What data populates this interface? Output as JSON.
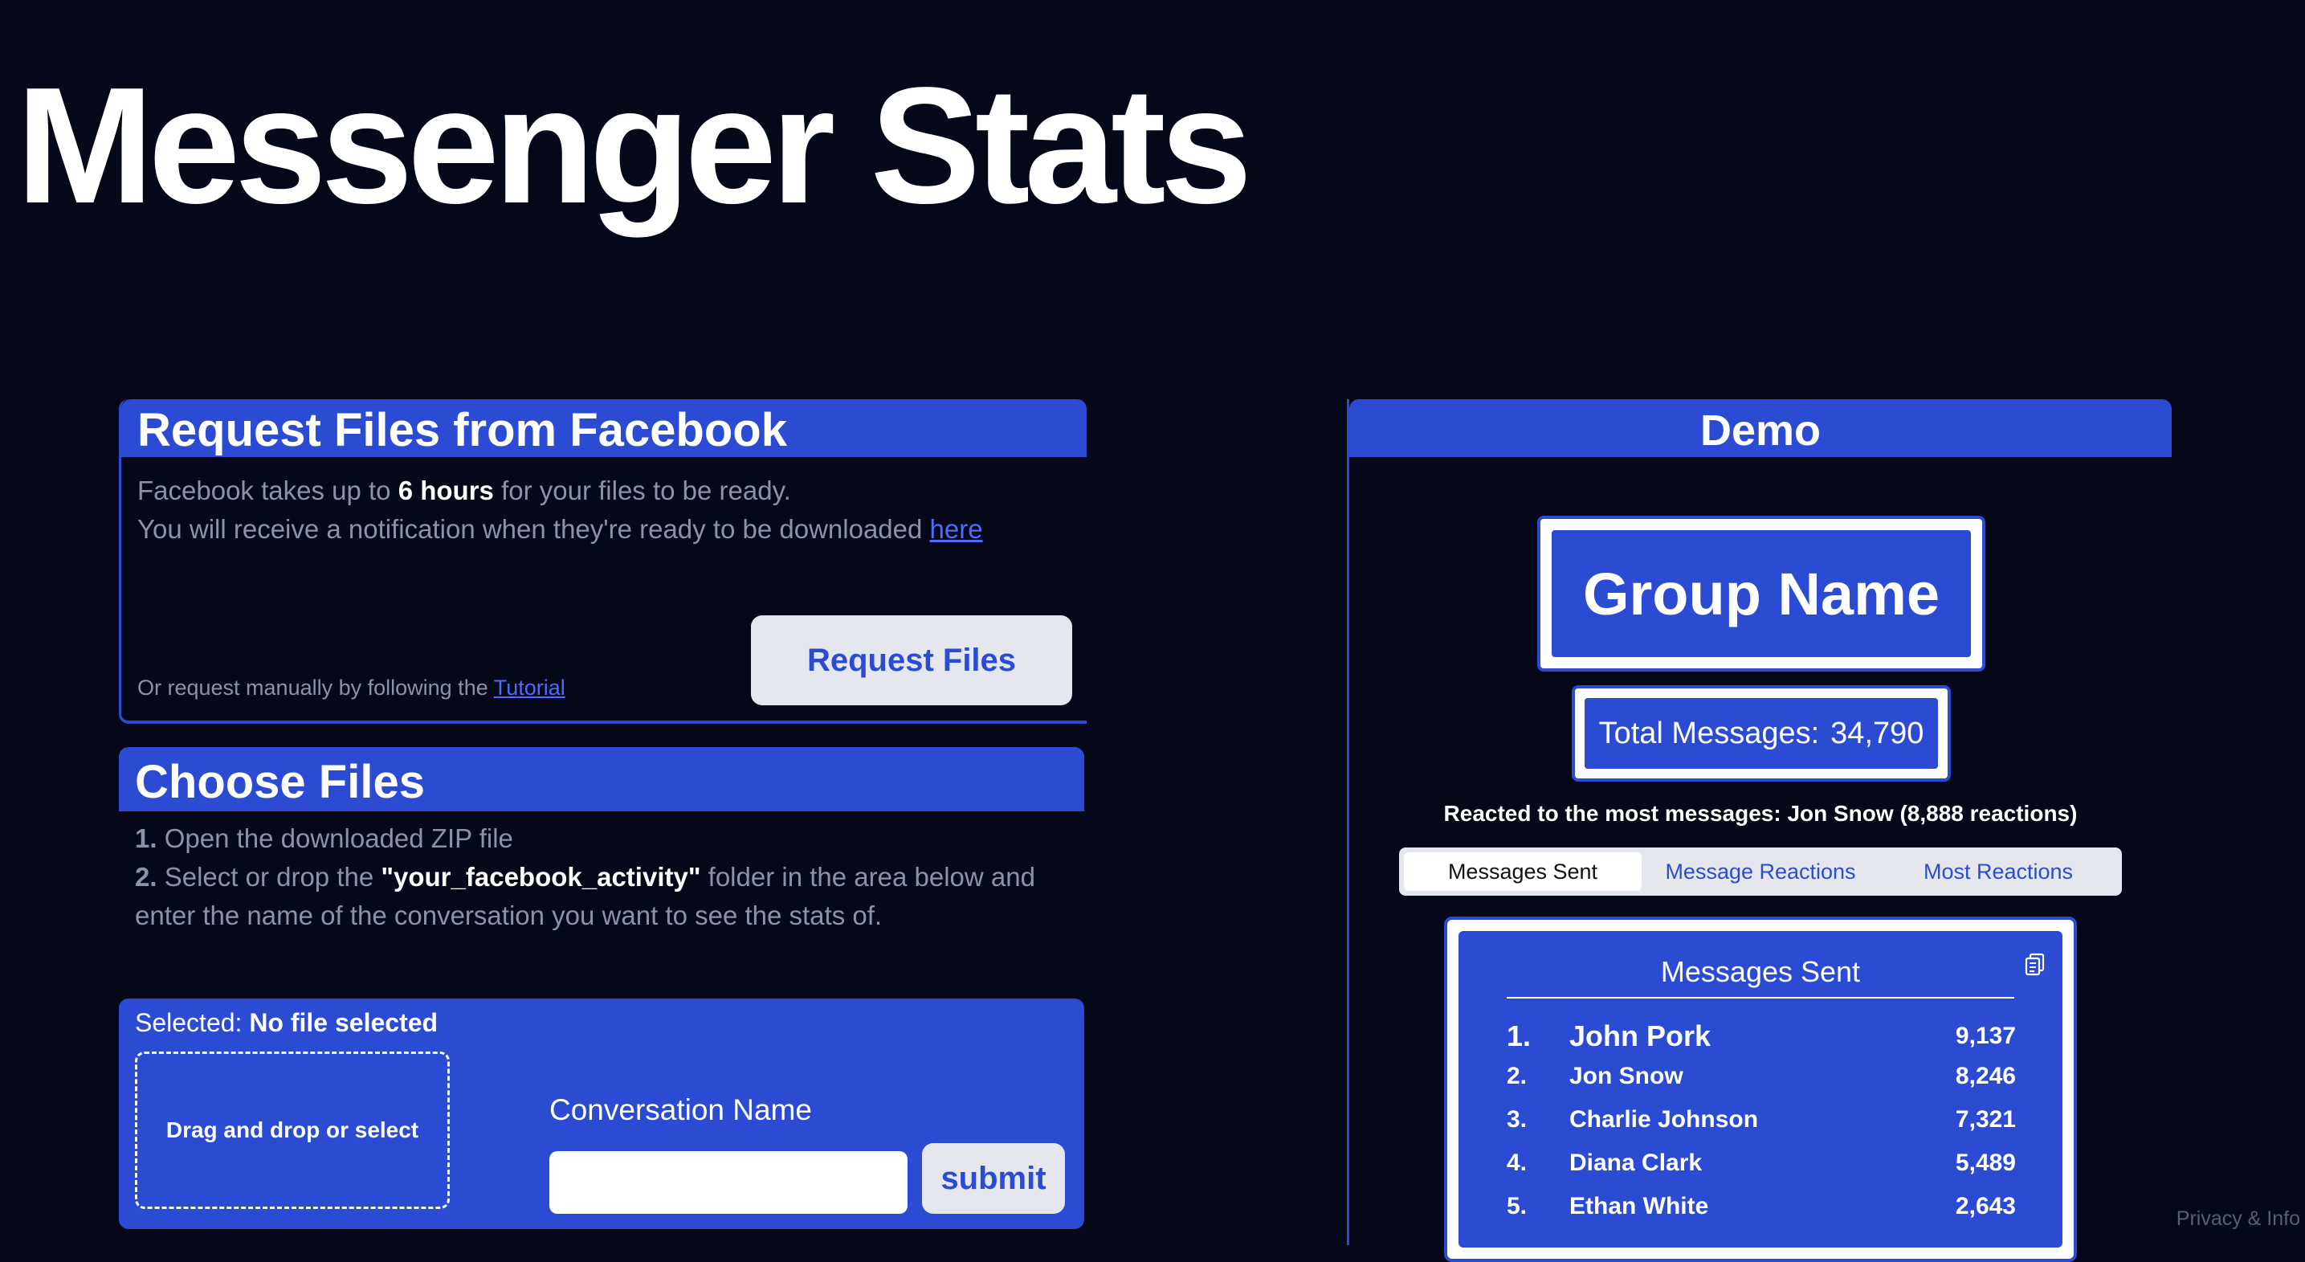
{
  "header": {
    "title": "Messenger Stats"
  },
  "request_card": {
    "title": "Request Files from Facebook",
    "line1_pre": "Facebook takes up to ",
    "line1_bold": "6 hours",
    "line1_post": " for your files to be ready.",
    "line2_pre": "You will receive a notification when they're ready to be downloaded ",
    "line2_link": "here",
    "manual_pre": "Or request manually by following the ",
    "manual_link": "Tutorial",
    "button": "Request Files"
  },
  "choose_card": {
    "title": "Choose Files",
    "step1_num": "1.",
    "step1_text": " Open the downloaded ZIP file",
    "step2_num": "2.",
    "step2_pre": " Select or drop the ",
    "step2_bold": "\"your_facebook_activity\"",
    "step2_post": " folder in the area below and enter the name of the conversation you want to see the stats of.",
    "selected_label": "Selected: ",
    "selected_value": "No file selected",
    "dropzone": "Drag and drop or select",
    "conversation_label": "Conversation Name",
    "conversation_value": "",
    "submit": "submit"
  },
  "demo": {
    "title": "Demo",
    "group_name": "Group Name",
    "total_label": "Total Messages:",
    "total_value": "34,790",
    "reacted": "Reacted to the most messages: Jon Snow (8,888 reactions)",
    "tabs": [
      "Messages Sent",
      "Message Reactions",
      "Most Reactions"
    ],
    "active_tab": "Messages Sent",
    "list_title": "Messages Sent",
    "rows": [
      {
        "rank": "1.",
        "name": "John Pork",
        "value": "9,137"
      },
      {
        "rank": "2.",
        "name": "Jon Snow",
        "value": "8,246"
      },
      {
        "rank": "3.",
        "name": "Charlie Johnson",
        "value": "7,321"
      },
      {
        "rank": "4.",
        "name": "Diana Clark",
        "value": "5,489"
      },
      {
        "rank": "5.",
        "name": "Ethan White",
        "value": "2,643"
      }
    ]
  },
  "footer": {
    "privacy": "Privacy & Info"
  },
  "colors": {
    "background": "#040818",
    "accent": "#2b4bd3",
    "light": "#e5e7ee",
    "link": "#4d6bff",
    "muted": "#8d93a6"
  },
  "icons": {
    "copy": "clipboard-copy-icon"
  }
}
